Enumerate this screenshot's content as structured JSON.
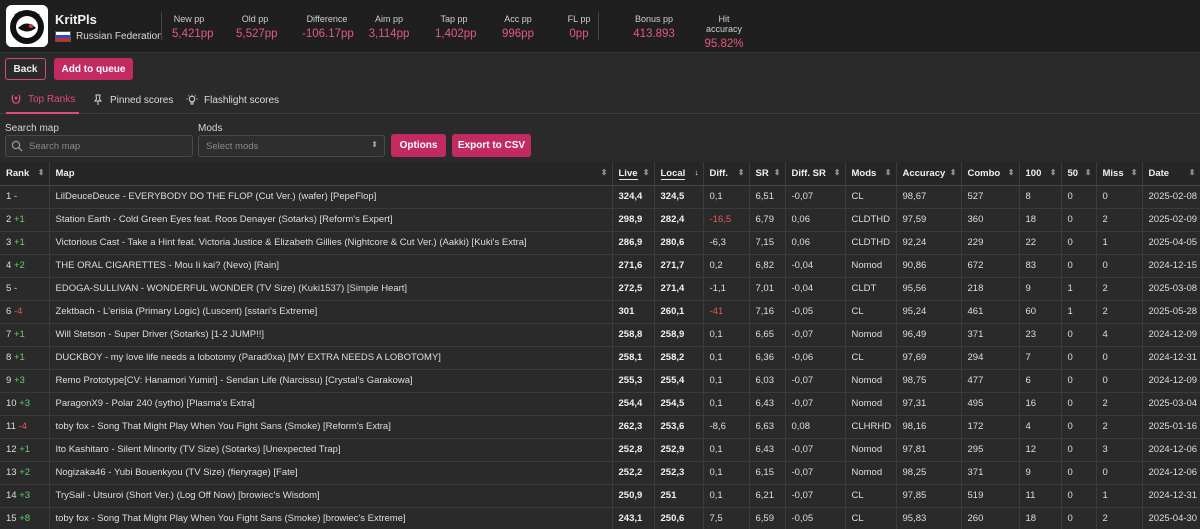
{
  "header": {
    "username": "KritPls",
    "country": "Russian Federation",
    "stats": [
      {
        "label": "New pp",
        "value": "5,421pp"
      },
      {
        "label": "Old pp",
        "value": "5,527pp"
      },
      {
        "label": "Difference",
        "value": "-106.17pp"
      },
      {
        "label": "Aim pp",
        "value": "3,114pp"
      },
      {
        "label": "Tap pp",
        "value": "1,402pp"
      },
      {
        "label": "Acc pp",
        "value": "996pp"
      },
      {
        "label": "FL pp",
        "value": "0pp"
      },
      {
        "label": "Bonus pp",
        "value": "413.893"
      },
      {
        "label": "Hit accuracy",
        "value": "95.82%"
      }
    ]
  },
  "actions": {
    "back": "Back",
    "add_to_queue": "Add to queue"
  },
  "tabs": [
    "Top Ranks",
    "Pinned scores",
    "Flashlight scores"
  ],
  "filters": {
    "search_label": "Search map",
    "search_placeholder": "Search map",
    "mods_label": "Mods",
    "mods_placeholder": "Select mods",
    "options": "Options",
    "export": "Export to CSV"
  },
  "table": {
    "columns": [
      "Rank",
      "Map",
      "Live",
      "Local",
      "Diff.",
      "SR",
      "Diff. SR",
      "Mods",
      "Accuracy",
      "Combo",
      "100",
      "50",
      "Miss",
      "Date"
    ],
    "rows": [
      {
        "rank": "1",
        "change": "-",
        "map": "LilDeuceDeuce - EVERYBODY DO THE FLOP (Cut Ver.) (wafer) [PepeFlop]",
        "live": "324,4",
        "local": "324,5",
        "diff": "0,1",
        "sr": "6,51",
        "dsr": "-0,07",
        "mods": "CL",
        "acc": "98,67",
        "combo": "527",
        "n100": "8",
        "n50": "0",
        "miss": "0",
        "date": "2025-02-08"
      },
      {
        "rank": "2",
        "change": "+1",
        "map": "Station Earth - Cold Green Eyes feat. Roos Denayer (Sotarks) [Reform's Expert]",
        "live": "298,9",
        "local": "282,4",
        "diff": "-16,5",
        "sr": "6,79",
        "dsr": "0,06",
        "mods": "CLDTHD",
        "acc": "97,59",
        "combo": "360",
        "n100": "18",
        "n50": "0",
        "miss": "2",
        "date": "2025-02-09"
      },
      {
        "rank": "3",
        "change": "+1",
        "map": "Victorious Cast - Take a Hint feat. Victoria Justice & Elizabeth Gillies (Nightcore & Cut Ver.) (Aakki) [Kuki's Extra]",
        "live": "286,9",
        "local": "280,6",
        "diff": "-6,3",
        "sr": "7,15",
        "dsr": "0,06",
        "mods": "CLDTHD",
        "acc": "92,24",
        "combo": "229",
        "n100": "22",
        "n50": "0",
        "miss": "1",
        "date": "2025-04-05"
      },
      {
        "rank": "4",
        "change": "+2",
        "map": "THE ORAL CIGARETTES - Mou Ii kai? (Nevo) [Rain]",
        "live": "271,6",
        "local": "271,7",
        "diff": "0,2",
        "sr": "6,82",
        "dsr": "-0,04",
        "mods": "Nomod",
        "acc": "90,86",
        "combo": "672",
        "n100": "83",
        "n50": "0",
        "miss": "0",
        "date": "2024-12-15"
      },
      {
        "rank": "5",
        "change": "-",
        "map": "EDOGA-SULLIVAN - WONDERFUL WONDER (TV Size) (Kuki1537) [Simple Heart]",
        "live": "272,5",
        "local": "271,4",
        "diff": "-1,1",
        "sr": "7,01",
        "dsr": "-0,04",
        "mods": "CLDT",
        "acc": "95,56",
        "combo": "218",
        "n100": "9",
        "n50": "1",
        "miss": "2",
        "date": "2025-03-08"
      },
      {
        "rank": "6",
        "change": "-4",
        "map": "Zektbach - L'erisia (Primary Logic) (Luscent) [sstari's Extreme]",
        "live": "301",
        "local": "260,1",
        "diff": "-41",
        "sr": "7,16",
        "dsr": "-0,05",
        "mods": "CL",
        "acc": "95,24",
        "combo": "461",
        "n100": "60",
        "n50": "1",
        "miss": "2",
        "date": "2025-05-28"
      },
      {
        "rank": "7",
        "change": "+1",
        "map": "Will Stetson - Super Driver (Sotarks) [1-2 JUMP!!]",
        "live": "258,8",
        "local": "258,9",
        "diff": "0,1",
        "sr": "6,65",
        "dsr": "-0,07",
        "mods": "Nomod",
        "acc": "96,49",
        "combo": "371",
        "n100": "23",
        "n50": "0",
        "miss": "4",
        "date": "2024-12-09"
      },
      {
        "rank": "8",
        "change": "+1",
        "map": "DUCKBOY - my love life needs a lobotomy (Parad0xa) [MY EXTRA NEEDS A LOBOTOMY]",
        "live": "258,1",
        "local": "258,2",
        "diff": "0,1",
        "sr": "6,36",
        "dsr": "-0,06",
        "mods": "CL",
        "acc": "97,69",
        "combo": "294",
        "n100": "7",
        "n50": "0",
        "miss": "0",
        "date": "2024-12-31"
      },
      {
        "rank": "9",
        "change": "+3",
        "map": "Remo Prototype[CV: Hanamori Yumiri] - Sendan Life (Narcissu) [Crystal's Garakowa]",
        "live": "255,3",
        "local": "255,4",
        "diff": "0,1",
        "sr": "6,03",
        "dsr": "-0,07",
        "mods": "Nomod",
        "acc": "98,75",
        "combo": "477",
        "n100": "6",
        "n50": "0",
        "miss": "0",
        "date": "2024-12-09"
      },
      {
        "rank": "10",
        "change": "+3",
        "map": "ParagonX9 - Polar 240 (sytho) [Plasma's Extra]",
        "live": "254,4",
        "local": "254,5",
        "diff": "0,1",
        "sr": "6,43",
        "dsr": "-0,07",
        "mods": "Nomod",
        "acc": "97,31",
        "combo": "495",
        "n100": "16",
        "n50": "0",
        "miss": "2",
        "date": "2025-03-04"
      },
      {
        "rank": "11",
        "change": "-4",
        "map": "toby fox - Song That Might Play When You Fight Sans (Smoke) [Reform's Extra]",
        "live": "262,3",
        "local": "253,6",
        "diff": "-8,6",
        "sr": "6,63",
        "dsr": "0,08",
        "mods": "CLHRHD",
        "acc": "98,16",
        "combo": "172",
        "n100": "4",
        "n50": "0",
        "miss": "2",
        "date": "2025-01-16"
      },
      {
        "rank": "12",
        "change": "+1",
        "map": "Ito Kashitaro - Silent Minority (TV Size) (Sotarks) [Unexpected Trap]",
        "live": "252,8",
        "local": "252,9",
        "diff": "0,1",
        "sr": "6,43",
        "dsr": "-0,07",
        "mods": "Nomod",
        "acc": "97,81",
        "combo": "295",
        "n100": "12",
        "n50": "0",
        "miss": "3",
        "date": "2024-12-06"
      },
      {
        "rank": "13",
        "change": "+2",
        "map": "Nogizaka46 - Yubi Bouenkyou (TV Size) (fieryrage) [Fate]",
        "live": "252,2",
        "local": "252,3",
        "diff": "0,1",
        "sr": "6,15",
        "dsr": "-0,07",
        "mods": "Nomod",
        "acc": "98,25",
        "combo": "371",
        "n100": "9",
        "n50": "0",
        "miss": "0",
        "date": "2024-12-06"
      },
      {
        "rank": "14",
        "change": "+3",
        "map": "TrySail - Utsuroi (Short Ver.) (Log Off Now) [browiec's Wisdom]",
        "live": "250,9",
        "local": "251",
        "diff": "0,1",
        "sr": "6,21",
        "dsr": "-0,07",
        "mods": "CL",
        "acc": "97,85",
        "combo": "519",
        "n100": "11",
        "n50": "0",
        "miss": "1",
        "date": "2024-12-31"
      },
      {
        "rank": "15",
        "change": "+8",
        "map": "toby fox - Song That Might Play When You Fight Sans (Smoke) [browiec's Extreme]",
        "live": "243,1",
        "local": "250,6",
        "diff": "7,5",
        "sr": "6,59",
        "dsr": "-0,05",
        "mods": "CL",
        "acc": "95,83",
        "combo": "260",
        "n100": "18",
        "n50": "0",
        "miss": "2",
        "date": "2025-04-30"
      }
    ]
  },
  "colors": {
    "accent": "#c42a62",
    "positive": "#5fd36a",
    "negative": "#e55a5a",
    "stat_value": "#e25b7d"
  }
}
